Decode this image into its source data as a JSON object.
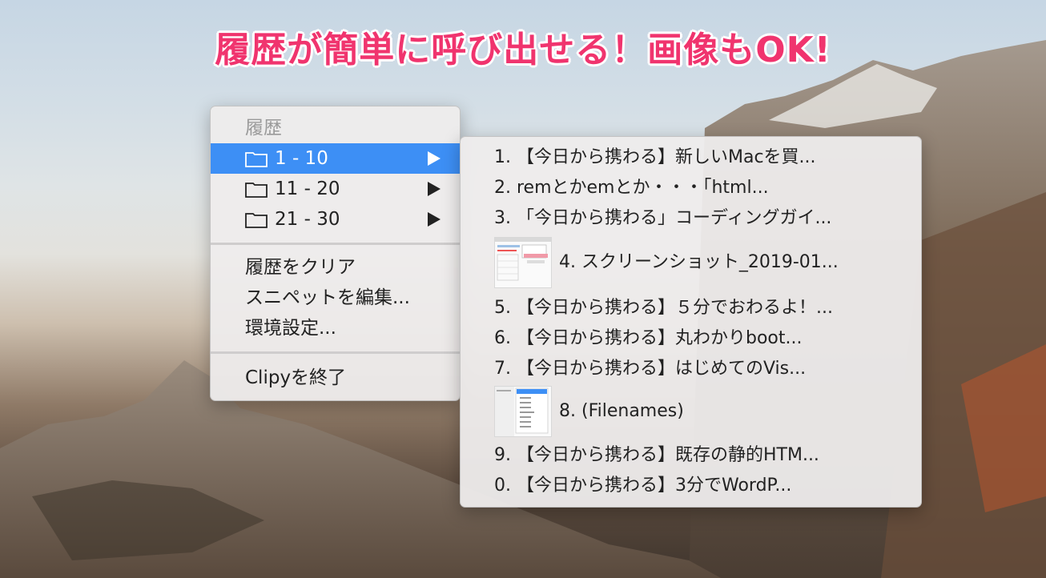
{
  "headline": "履歴が簡単に呼び出せる！画像もOK!",
  "menu": {
    "header": "履歴",
    "folders": [
      {
        "label": "1 - 10",
        "selected": true
      },
      {
        "label": "11 - 20",
        "selected": false
      },
      {
        "label": "21 - 30",
        "selected": false
      }
    ],
    "clear_history": "履歴をクリア",
    "edit_snippets": "スニペットを編集...",
    "preferences": "環境設定...",
    "quit": "Clipyを終了"
  },
  "submenu": {
    "items": [
      {
        "label": "1. 【今日から携わる】新しいMacを買..."
      },
      {
        "label": "2. remとかemとか・・・「html..."
      },
      {
        "label": "3. 「今日から携わる」コーディングガイ..."
      },
      {
        "label": "4. スクリーンショット_2019-01...",
        "icon": "screenshot-thumbnail-icon"
      },
      {
        "label": "5. 【今日から携わる】５分でおわるよ！..."
      },
      {
        "label": "6. 【今日から携わる】丸わかりboot..."
      },
      {
        "label": "7. 【今日から携わる】はじめてのVis..."
      },
      {
        "label": "8. (Filenames)",
        "icon": "filenames-thumbnail-icon"
      },
      {
        "label": "9. 【今日から携わる】既存の静的HTM..."
      },
      {
        "label": "0. 【今日から携わる】3分でWordP..."
      }
    ]
  },
  "colors": {
    "highlight": "#3d8ff5",
    "headline": "#f0346e"
  }
}
